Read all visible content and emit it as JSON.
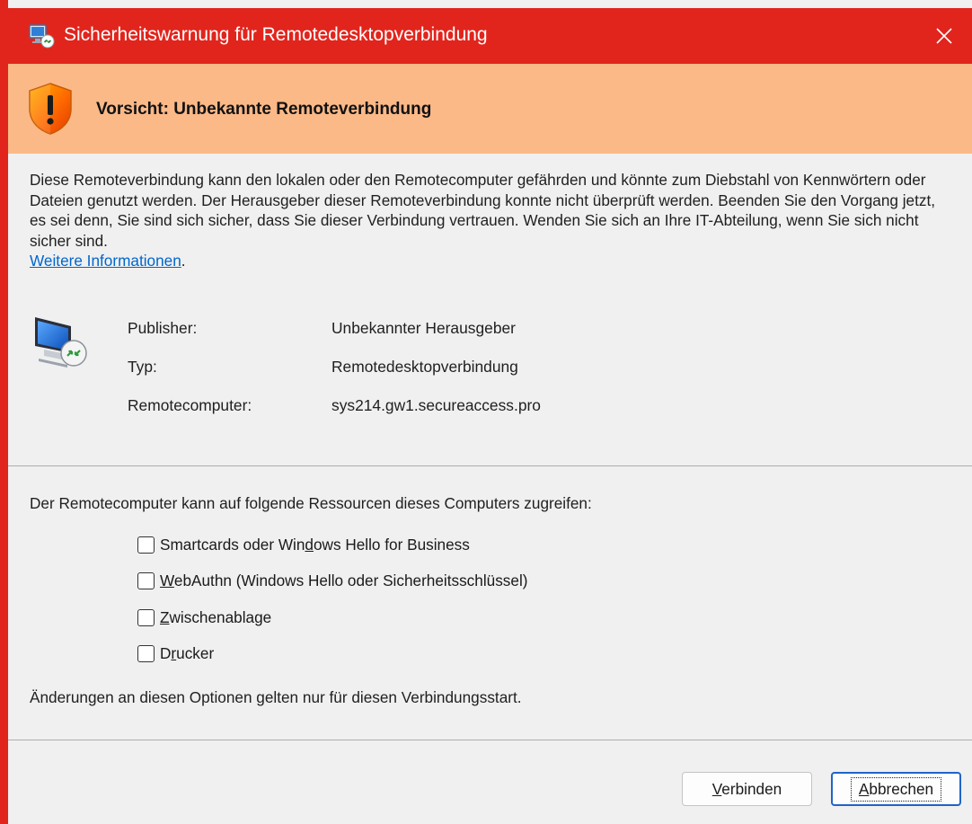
{
  "window": {
    "title": "Sicherheitswarnung für Remotedesktopverbindung",
    "accent_color": "#e1251d",
    "warning_band_color": "#fbb988"
  },
  "warning": {
    "heading": "Vorsicht: Unbekannte Remoteverbindung",
    "icon": "shield-warning-icon"
  },
  "description": {
    "text": "Diese Remoteverbindung kann den lokalen oder den Remotecomputer gefährden und könnte zum Diebstahl von Kennwörtern oder Dateien genutzt werden. Der Herausgeber dieser Remoteverbindung konnte nicht überprüft werden. Beenden Sie den Vorgang jetzt, es sei denn, Sie sind sich sicher, dass Sie dieser Verbindung vertrauen. Wenden Sie sich an Ihre IT-Abteilung, wenn Sie sich nicht sicher sind.",
    "link": "Weitere Informationen",
    "link_suffix": "."
  },
  "details": [
    {
      "label": "Publisher:",
      "value": "Unbekannter Herausgeber"
    },
    {
      "label": "Typ:",
      "value": "Remotedesktopverbindung"
    },
    {
      "label": "Remotecomputer:",
      "value": "sys214.gw1.secureaccess.pro"
    }
  ],
  "resources": {
    "intro": "Der Remotecomputer kann auf folgende Ressourcen dieses Computers zugreifen:",
    "options": [
      {
        "pre": "Smartcards oder Win",
        "accel": "d",
        "post": "ows Hello for Business",
        "checked": false
      },
      {
        "pre": "",
        "accel": "W",
        "post": "ebAuthn (Windows Hello oder Sicherheitsschlüssel)",
        "checked": false
      },
      {
        "pre": "",
        "accel": "Z",
        "post": "wischenablage",
        "checked": false
      },
      {
        "pre": "D",
        "accel": "r",
        "post": "ucker",
        "checked": false
      }
    ],
    "note": "Änderungen an diesen Optionen gelten nur für diesen Verbindungsstart."
  },
  "buttons": {
    "connect": {
      "accel": "V",
      "rest": "erbinden"
    },
    "cancel": {
      "accel": "A",
      "rest": "bbrechen"
    }
  }
}
